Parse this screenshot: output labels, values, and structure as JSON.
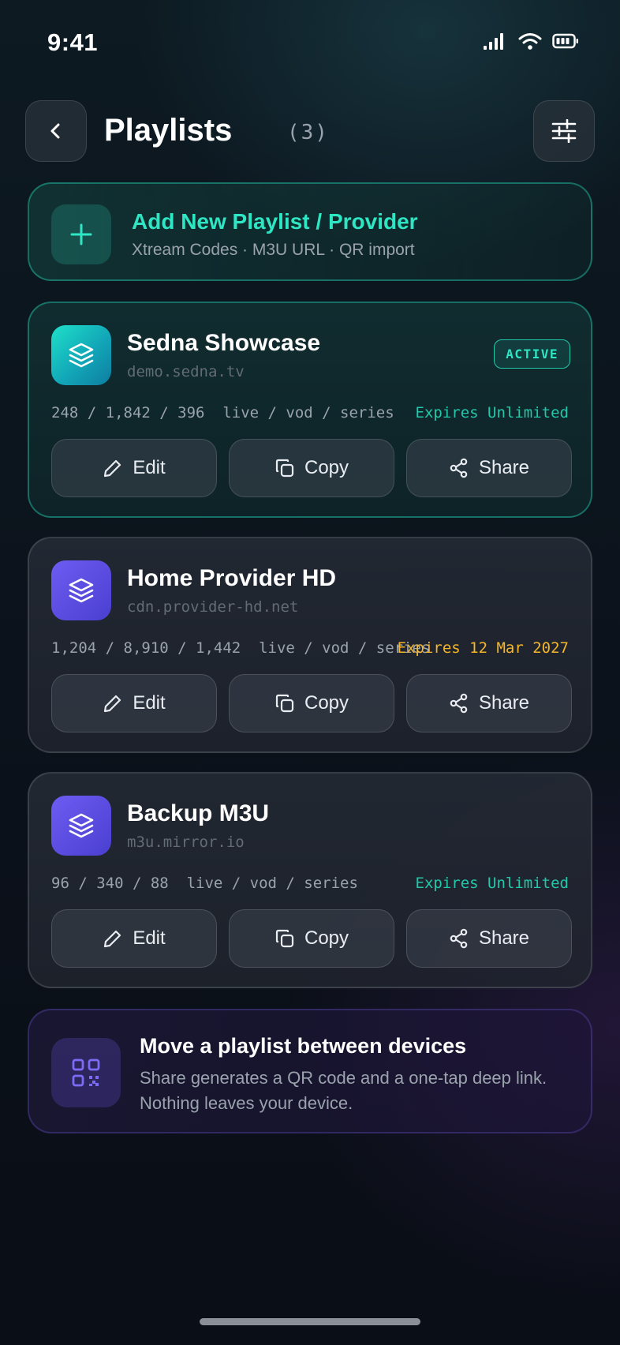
{
  "status_bar": {
    "time": "9:41",
    "icons": [
      "signal-icon",
      "wifi-icon",
      "battery-icon"
    ]
  },
  "header": {
    "title": "Playlists",
    "count": "(3)"
  },
  "add_card": {
    "title": "Add New Playlist / Provider",
    "subtitle": "Xtream Codes · M3U URL · QR import"
  },
  "playlists": [
    {
      "name": "Sedna Showcase",
      "host": "demo.sedna.tv",
      "badge": "ACTIVE",
      "stats": "248 / 1,842 / 396  live / vod / series",
      "expiry": "Expires Unlimited",
      "expiry_color": "#23c8aa",
      "actions": {
        "edit": "Edit",
        "copy": "Copy",
        "share": "Share"
      }
    },
    {
      "name": "Home Provider HD",
      "host": "cdn.provider-hd.net",
      "stats": "1,204 / 8,910 / 1,442  live / vod / series",
      "expiry": "Expires 12 Mar 2027",
      "expiry_color": "#f5b62a",
      "actions": {
        "edit": "Edit",
        "copy": "Copy",
        "share": "Share"
      }
    },
    {
      "name": "Backup M3U",
      "host": "m3u.mirror.io",
      "stats": "96 / 340 / 88  live / vod / series",
      "expiry": "Expires Unlimited",
      "expiry_color": "#23c8aa",
      "actions": {
        "edit": "Edit",
        "copy": "Copy",
        "share": "Share"
      }
    }
  ],
  "info_card": {
    "title": "Move a playlist between devices",
    "body": "Share generates a QR code and a one-tap deep link. Nothing leaves your device."
  },
  "colors": {
    "accent": "#2ee6c4",
    "warning": "#f5b62a",
    "purple": "#6e5cf2"
  }
}
